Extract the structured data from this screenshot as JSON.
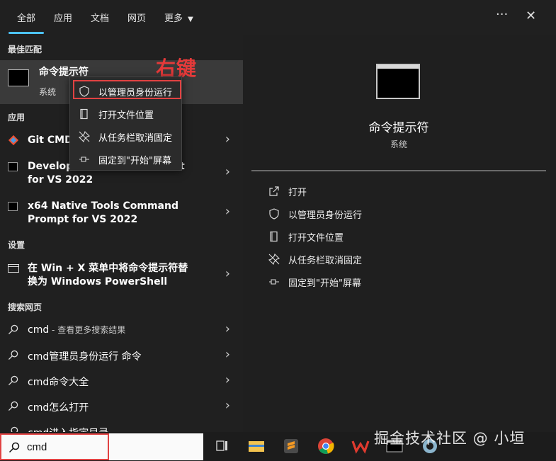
{
  "tabs": [
    {
      "label": "全部"
    },
    {
      "label": "应用"
    },
    {
      "label": "文档"
    },
    {
      "label": "网页"
    },
    {
      "label": "更多"
    }
  ],
  "top_icons": {
    "more": "···",
    "close": "✕",
    "more_icon": "ellipsis-icon",
    "close_icon": "close-icon"
  },
  "sections": {
    "best_match": "最佳匹配",
    "apps": "应用",
    "settings": "设置",
    "web": "搜索网页"
  },
  "best_match": {
    "title": "命令提示符",
    "subtitle": "系统"
  },
  "annotation": "右键",
  "context_menu": [
    {
      "label": "以管理员身份运行",
      "icon": "shield-icon"
    },
    {
      "label": "打开文件位置",
      "icon": "folder-icon"
    },
    {
      "label": "从任务栏取消固定",
      "icon": "unpin-icon"
    },
    {
      "label": "固定到\"开始\"屏幕",
      "icon": "pin-icon"
    }
  ],
  "apps": [
    {
      "line1": "Git CMD",
      "line2": ""
    },
    {
      "line1": "Develop",
      "line1_tail": "t",
      "line2": "for VS 2022"
    },
    {
      "line1": "x64 Native Tools Command",
      "line2": "Prompt for VS 2022"
    }
  ],
  "settings_item": {
    "line1": "在 Win + X 菜单中将命令提示符替",
    "line2": "换为 Windows PowerShell"
  },
  "web_results": [
    {
      "bold": "cmd",
      "rest": " - 查看更多搜索结果"
    },
    {
      "bold": "cmd管理员身份运行 命令",
      "rest": ""
    },
    {
      "bold": "cmd命令大全",
      "rest": ""
    },
    {
      "bold": "cmd怎么打开",
      "rest": ""
    },
    {
      "bold": "cmd进入指定目录",
      "rest": ""
    }
  ],
  "preview": {
    "title": "命令提示符",
    "subtitle": "系统"
  },
  "preview_actions": [
    {
      "label": "打开",
      "icon": "open-icon"
    },
    {
      "label": "以管理员身份运行",
      "icon": "shield-icon"
    },
    {
      "label": "打开文件位置",
      "icon": "folder-icon"
    },
    {
      "label": "从任务栏取消固定",
      "icon": "unpin-icon"
    },
    {
      "label": "固定到\"开始\"屏幕",
      "icon": "pin-icon"
    }
  ],
  "search": {
    "value": "cmd"
  },
  "watermark": "掘金技术社区 @ 小垣",
  "colors": {
    "accent": "#4cc2ff",
    "highlight": "#e14242",
    "annotation": "#e53a3a"
  }
}
